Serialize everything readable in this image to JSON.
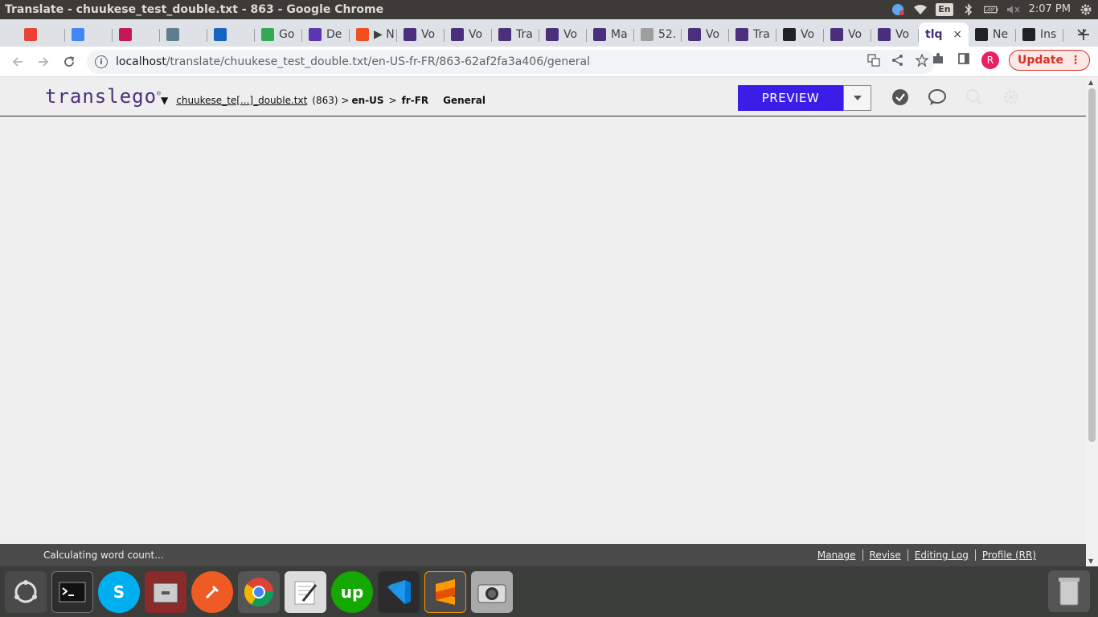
{
  "window": {
    "title": "Translate - chuukese_test_double.txt - 863 - Google Chrome",
    "clock": "2:07 PM",
    "keyboard_layout": "En"
  },
  "tabs": [
    {
      "label": "",
      "fav": "gmail-icon",
      "color": "#ea4335"
    },
    {
      "label": "",
      "fav": "wave-icon",
      "color": "#4285f4"
    },
    {
      "label": "",
      "fav": "trello-like-icon",
      "color": "#c2185b"
    },
    {
      "label": "",
      "fav": "grid-icon",
      "color": "#607d8b"
    },
    {
      "label": "",
      "fav": "trello-icon",
      "color": "#1565c0"
    },
    {
      "label": "Go",
      "fav": "google-icon",
      "color": "#34a853"
    },
    {
      "label": "De",
      "fav": "docs-icon",
      "color": "#5e35b1"
    },
    {
      "label": "▶ N",
      "fav": "figma-icon",
      "color": "#f24e1e"
    },
    {
      "label": "Vo",
      "fav": "translego-icon",
      "color": "#4a2f7d"
    },
    {
      "label": "Vo",
      "fav": "translego-icon",
      "color": "#4a2f7d"
    },
    {
      "label": "Tra",
      "fav": "translego-icon",
      "color": "#4a2f7d"
    },
    {
      "label": "Vo",
      "fav": "translego-icon",
      "color": "#4a2f7d"
    },
    {
      "label": "Ma",
      "fav": "translego-icon",
      "color": "#4a2f7d"
    },
    {
      "label": "52.",
      "fav": "globe-icon",
      "color": "#9e9e9e"
    },
    {
      "label": "Vo",
      "fav": "translego-icon",
      "color": "#4a2f7d"
    },
    {
      "label": "Tra",
      "fav": "translego-icon",
      "color": "#4a2f7d"
    },
    {
      "label": "Vo",
      "fav": "clock-icon",
      "color": "#202124"
    },
    {
      "label": "Vo",
      "fav": "translego-icon",
      "color": "#4a2f7d"
    },
    {
      "label": "Vo",
      "fav": "translego-icon",
      "color": "#4a2f7d"
    }
  ],
  "active_tab": {
    "label": "tlq ",
    "close": "×"
  },
  "tabs_after": [
    {
      "label": "Ne",
      "fav": "github-icon",
      "color": "#202124"
    },
    {
      "label": "Ins",
      "fav": "clock-icon",
      "color": "#202124"
    }
  ],
  "newtab_label": "+",
  "omnibox": {
    "host": "localhost",
    "path": "/translate/chuukese_test_double.txt/en-US-fr-FR/863-62af2fa3a406/general"
  },
  "profile_initial": "R",
  "update_label": "Update",
  "app": {
    "logo": "translego",
    "breadcrumb": {
      "file": "chuukese_te[...]_double.txt",
      "id": "(863) >",
      "source_lang": "en-US",
      "sep": ">",
      "target_lang": "fr-FR",
      "section": "General"
    },
    "preview_label": "PREVIEW"
  },
  "status": {
    "message": "Calculating word count...",
    "links": [
      "Manage",
      "Revise",
      "Editing Log",
      "Profile (RR)"
    ]
  },
  "colors": {
    "accent": "#3a1ee8",
    "logo": "#4a2f7d",
    "update": "#d93025"
  }
}
